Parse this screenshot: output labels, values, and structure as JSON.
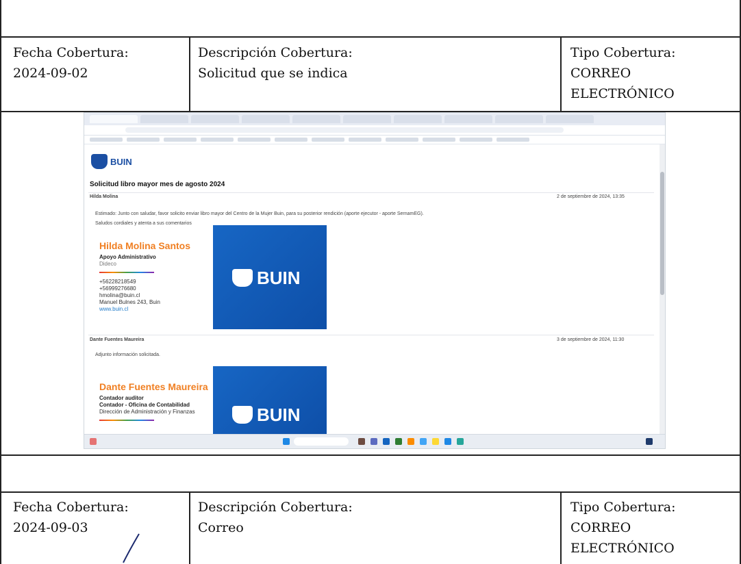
{
  "rows": [
    {
      "fecha_label": "Fecha Cobertura:",
      "fecha_value": "2024-09-02",
      "desc_label": "Descripción Cobertura:",
      "desc_value": "Solicitud que se indica",
      "tipo_label": "Tipo Cobertura:",
      "tipo_value_1": "CORREO",
      "tipo_value_2": "ELECTRÓNICO"
    },
    {
      "fecha_label": "Fecha Cobertura:",
      "fecha_value": "2024-09-03",
      "desc_label": "Descripción Cobertura:",
      "desc_value": "Correo",
      "tipo_label": "Tipo Cobertura:",
      "tipo_value_1": "CORREO",
      "tipo_value_2": "ELECTRÓNICO"
    }
  ],
  "email": {
    "logo": "BUIN",
    "subject": "Solicitud libro mayor mes de agosto 2024",
    "message1": {
      "sender": "Hilda Molina",
      "date": "2 de septiembre de 2024, 13:35",
      "body": "Estimado: Junto con saludar, favor solicito enviar libro mayor del Centro de la Mujer Buin, para su posterior rendición (aporte ejecutor - aporte SernamEG).",
      "closing": "Saludos cordiales y atenta a sus comentarios",
      "sig_name": "Hilda Molina Santos",
      "sig_role": "Apoyo Administrativo",
      "sig_dept": "Dideco",
      "sig_phone1": "+56228218549",
      "sig_phone2": "+56999276680",
      "sig_email": "hmolina@buin.cl",
      "sig_address": "Manuel Bulnes 243, Buin",
      "sig_web": "www.buin.cl"
    },
    "message2": {
      "sender": "Dante Fuentes Maureira",
      "date": "3 de septiembre de 2024, 11:30",
      "body": "Adjunto información solicitada.",
      "sig_name": "Dante Fuentes Maureira",
      "sig_role1": "Contador auditor",
      "sig_role2": "Contador - Oficina de Contabilidad",
      "sig_dept": "Dirección de Administración y Finanzas"
    },
    "banner_text": "BUIN"
  }
}
